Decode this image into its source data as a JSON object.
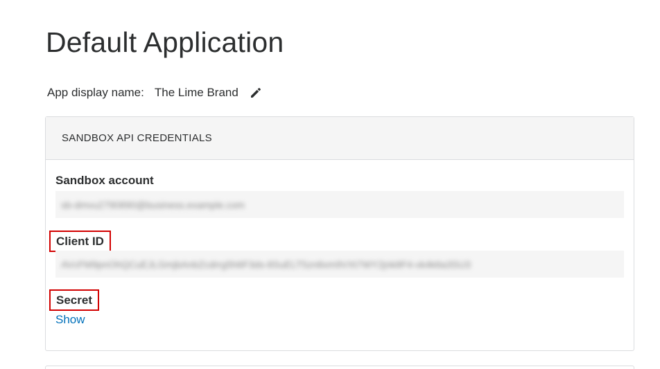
{
  "page": {
    "title": "Default Application"
  },
  "app": {
    "display_name_label": "App display name:",
    "display_name_value": "The Lime Brand",
    "edit_icon": "pencil-icon"
  },
  "credentials": {
    "header": "SANDBOX API CREDENTIALS",
    "sandbox_account_label": "Sandbox account",
    "sandbox_account_value": "sb-dmvu2790890@business.example.com",
    "client_id_label": "Client ID",
    "client_id_value": "AVcFM9pnOhQCuEJLGmjbAnbZcdrrg5h6F3ds-8SuELT5zn8xm9VXt7WY2jnk8F4-vk4k6a3SU3",
    "secret_label": "Secret",
    "show_link": "Show"
  },
  "colors": {
    "link": "#0070ba",
    "highlight_border": "#d20000"
  }
}
